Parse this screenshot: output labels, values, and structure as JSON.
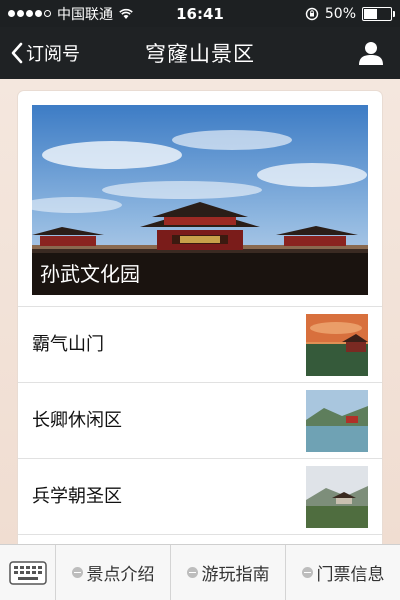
{
  "status_bar": {
    "carrier": "中国联通",
    "time": "16:41",
    "battery": "50%",
    "signal_bars_filled": 4,
    "signal_bars_total": 5,
    "battery_level": 0.5
  },
  "nav": {
    "back_label": "订阅号",
    "title": "穹窿山景区"
  },
  "hero": {
    "caption": "孙武文化园"
  },
  "list": [
    {
      "label": "霸气山门"
    },
    {
      "label": "长卿休闲区"
    },
    {
      "label": "兵学朝圣区"
    },
    {
      "label": ""
    }
  ],
  "menu": [
    {
      "label": "景点介绍"
    },
    {
      "label": "游玩指南"
    },
    {
      "label": "门票信息"
    }
  ],
  "colors": {
    "bar_dark": "#1f2224",
    "page_bg": "#f3e6dd",
    "menu_bg": "#f7f7f7"
  }
}
